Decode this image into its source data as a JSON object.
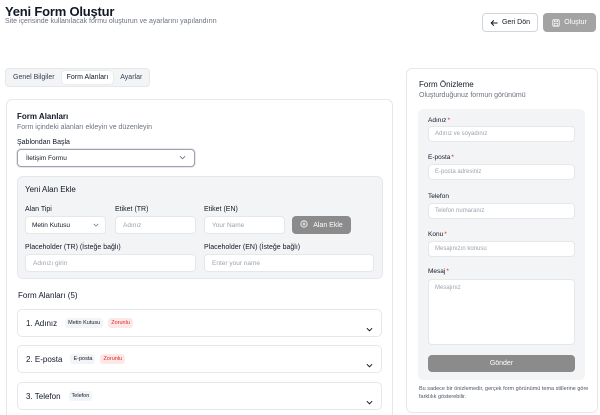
{
  "header": {
    "title": "Yeni Form Oluştur",
    "subtitle": "Site içerisinde kullanılacak formu oluşturun ve ayarlarını yapılandırın",
    "back_label": "Geri Dön",
    "create_label": "Oluştur"
  },
  "tabs": [
    {
      "label": "Genel Bilgiler",
      "active": false
    },
    {
      "label": "Form Alanları",
      "active": true
    },
    {
      "label": "Ayarlar",
      "active": false
    }
  ],
  "form_fields_card": {
    "title": "Form Alanları",
    "subtitle": "Form içindeki alanları ekleyin ve düzenleyin",
    "template_label": "Şablondan Başla",
    "template_value": "İletişim Formu"
  },
  "new_field": {
    "title": "Yeni Alan Ekle",
    "type_label": "Alan Tipi",
    "type_value": "Metin Kutusu",
    "label_tr_label": "Etiket (TR)",
    "label_tr_placeholder": "Adınız",
    "label_en_label": "Etiket (EN)",
    "label_en_placeholder": "Your Name",
    "add_button": "Alan Ekle",
    "placeholder_tr_label": "Placeholder (TR) (İsteğe bağlı)",
    "placeholder_tr_placeholder": "Adınızı girin",
    "placeholder_en_label": "Placeholder (EN) (İsteğe bağlı)",
    "placeholder_en_placeholder": "Enter your name"
  },
  "field_list": {
    "title": "Form Alanları (5)",
    "items": [
      {
        "title": "1. Adınız",
        "type": "Metin Kutusu",
        "required": "Zorunlu"
      },
      {
        "title": "2. E-posta",
        "type": "E-posta",
        "required": "Zorunlu"
      },
      {
        "title": "3. Telefon",
        "type": "Telefon",
        "required": ""
      }
    ]
  },
  "preview": {
    "title": "Form Önizleme",
    "subtitle": "Oluşturduğunuz formun görünümü",
    "fields": [
      {
        "label": "Adınız",
        "required": "*",
        "placeholder": "Adınız ve soyadınız"
      },
      {
        "label": "E-posta",
        "required": "*",
        "placeholder": "E-posta adresiniz"
      },
      {
        "label": "Telefon",
        "required": "",
        "placeholder": "Telefon numaranız"
      },
      {
        "label": "Konu",
        "required": "*",
        "placeholder": "Mesajınızın konusu"
      },
      {
        "label": "Mesaj",
        "required": "*",
        "placeholder": "Mesajınız"
      }
    ],
    "send_label": "Gönder",
    "note": "Bu sadece bir önizlemedir, gerçek form görünümü tema stillerine göre farklılık gösterebilir."
  },
  "icons": {
    "back": "arrow-left-icon",
    "create": "save-icon",
    "add": "plus-circle-icon",
    "dropdown": "chevron-down-icon"
  },
  "colors": {
    "primary_button": "#a3a3a3",
    "secondary_button": "#8b8b8b",
    "required": "#dc2626",
    "required_bg": "#fde8e8"
  }
}
